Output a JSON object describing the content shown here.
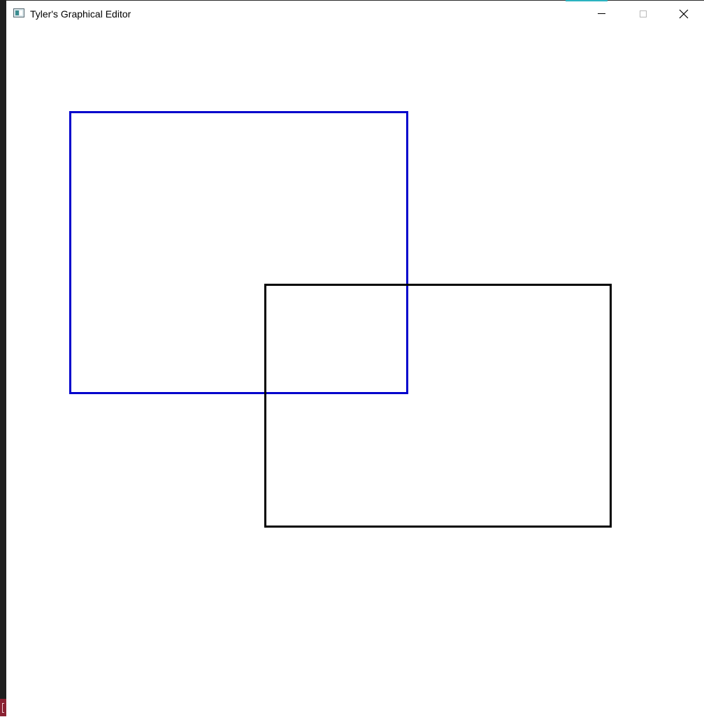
{
  "window": {
    "title": "Tyler's Graphical Editor",
    "app_icon": "app-window-icon",
    "controls": {
      "minimize_icon": "minimize-icon",
      "maximize_icon": "maximize-icon",
      "maximize_enabled": false,
      "close_icon": "close-icon"
    }
  },
  "canvas": {
    "background": "#ffffff",
    "shapes": [
      {
        "type": "rectangle",
        "stroke": "#0000cc"
      },
      {
        "type": "rectangle",
        "stroke": "#000000"
      }
    ]
  },
  "colors": {
    "accent": "#2bb3c0",
    "taskbar_stub": "#8a2232"
  }
}
